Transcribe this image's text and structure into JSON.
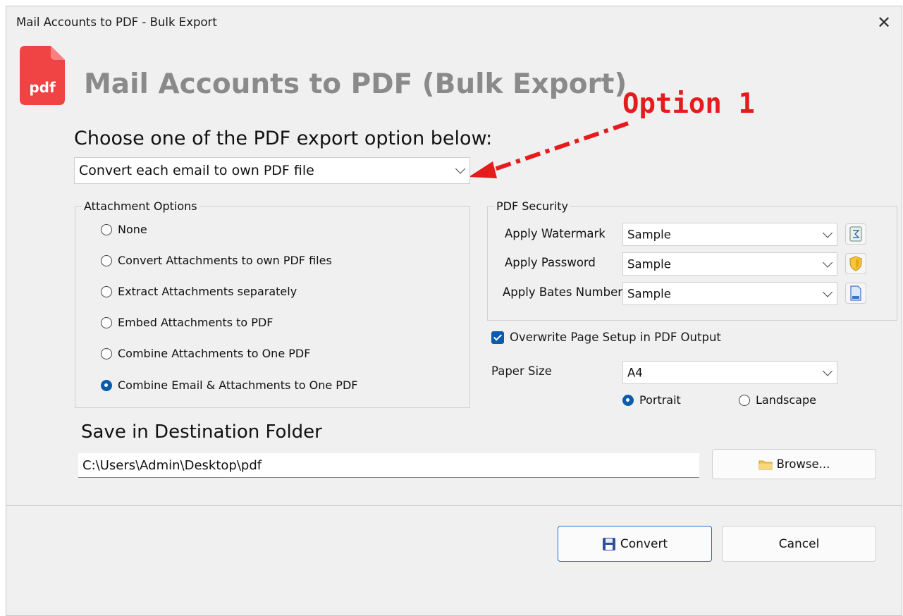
{
  "window": {
    "title": "Mail Accounts to PDF - Bulk Export",
    "close_glyph": "✕"
  },
  "app": {
    "logo_text": "pdf",
    "heading": "Mail Accounts to PDF (Bulk Export)"
  },
  "annotation": {
    "label": "Option 1",
    "color": "#e51c1c"
  },
  "export": {
    "prompt": "Choose one of the PDF export option below:",
    "selected": "Convert each email to own PDF file"
  },
  "attachment_options": {
    "legend": "Attachment Options",
    "items": [
      {
        "label": "None",
        "checked": false
      },
      {
        "label": "Convert Attachments to own PDF files",
        "checked": false
      },
      {
        "label": "Extract Attachments separately",
        "checked": false
      },
      {
        "label": "Embed Attachments to PDF",
        "checked": false
      },
      {
        "label": "Combine Attachments to One PDF",
        "checked": false
      },
      {
        "label": "Combine Email & Attachments to One PDF",
        "checked": true
      }
    ]
  },
  "pdf_security": {
    "legend": "PDF Security",
    "rows": [
      {
        "label": "Apply Watermark",
        "value": "Sample",
        "icon": "watermark-icon"
      },
      {
        "label": "Apply Password",
        "value": "Sample",
        "icon": "shield-icon"
      },
      {
        "label": "Apply Bates Number",
        "value": "Sample",
        "icon": "document-icon"
      }
    ]
  },
  "page_setup": {
    "overwrite_label": "Overwrite Page Setup in PDF Output",
    "overwrite_checked": true,
    "paper_size_label": "Paper Size",
    "paper_size_value": "A4",
    "orientation": [
      {
        "label": "Portrait",
        "checked": true
      },
      {
        "label": "Landscape",
        "checked": false
      }
    ]
  },
  "destination": {
    "label": "Save in Destination Folder",
    "path": "C:\\Users\\Admin\\Desktop\\pdf",
    "browse_label": "Browse..."
  },
  "actions": {
    "convert_label": "Convert",
    "cancel_label": "Cancel"
  },
  "colors": {
    "accent": "#0b5cab",
    "logo_red": "#f04343",
    "heading_gray": "#8a8a8a"
  }
}
